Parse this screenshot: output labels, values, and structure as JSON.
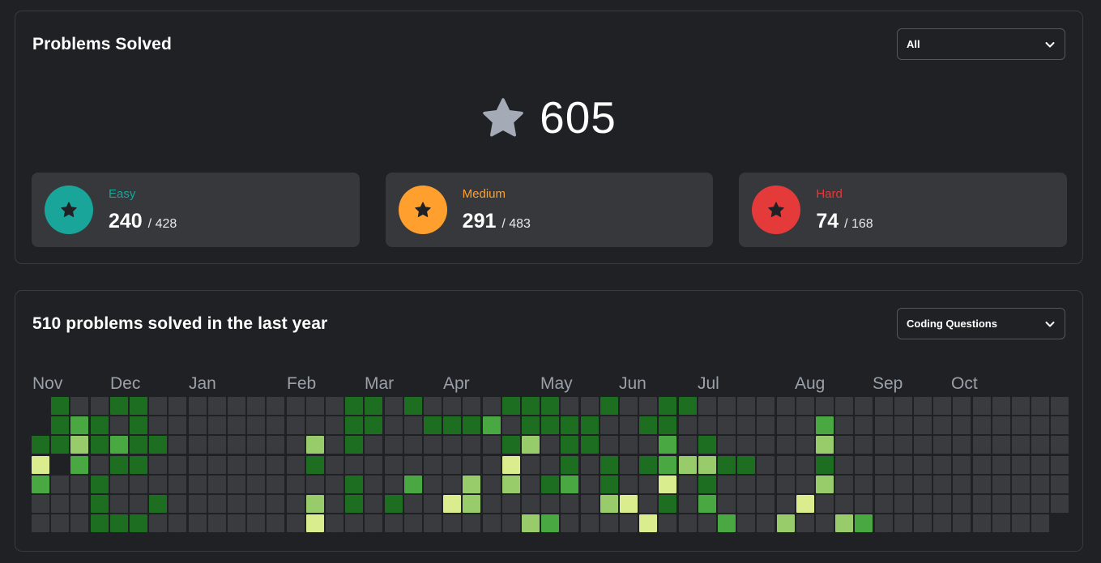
{
  "solved_card": {
    "title": "Problems Solved",
    "filter": {
      "selected": "All"
    },
    "total": "605",
    "difficulties": [
      {
        "name": "Easy",
        "solved": "240",
        "total": "/ 428",
        "color": "#1aa59b"
      },
      {
        "name": "Medium",
        "solved": "291",
        "total": "/ 483",
        "color": "#ffa02e"
      },
      {
        "name": "Hard",
        "solved": "74",
        "total": "/ 168",
        "color": "#e53a3a"
      }
    ]
  },
  "activity_card": {
    "title": "510 problems solved in the last year",
    "filter": {
      "selected": "Coding Questions"
    },
    "months": [
      "Nov",
      "Dec",
      "Jan",
      "Feb",
      "Mar",
      "Apr",
      "May",
      "Jun",
      "Jul",
      "Aug",
      "Sep",
      "Oct"
    ],
    "legend_colors": {
      "empty": "#3a3b3e",
      "level1": "#d9ec8e",
      "level2": "#98cc6b",
      "level3": "#4aa843",
      "level4": "#1e6e22"
    },
    "heatmap_rows": [
      "-4..44..........44.4....444..4..44.......",
      "-434.4..........44..4443.4444..44.......3",
      "4424344.......2.4.......42.44...3.4.....2",
      "1-3.44........4.........1..4.4.432244...4",
      "3..4............4..3..2.2.43.4..1.4.....2",
      "...4..4.......2.4.4..12......21.4.3....1.",
      "...444........1..........23....1...3..2..23"
    ]
  }
}
